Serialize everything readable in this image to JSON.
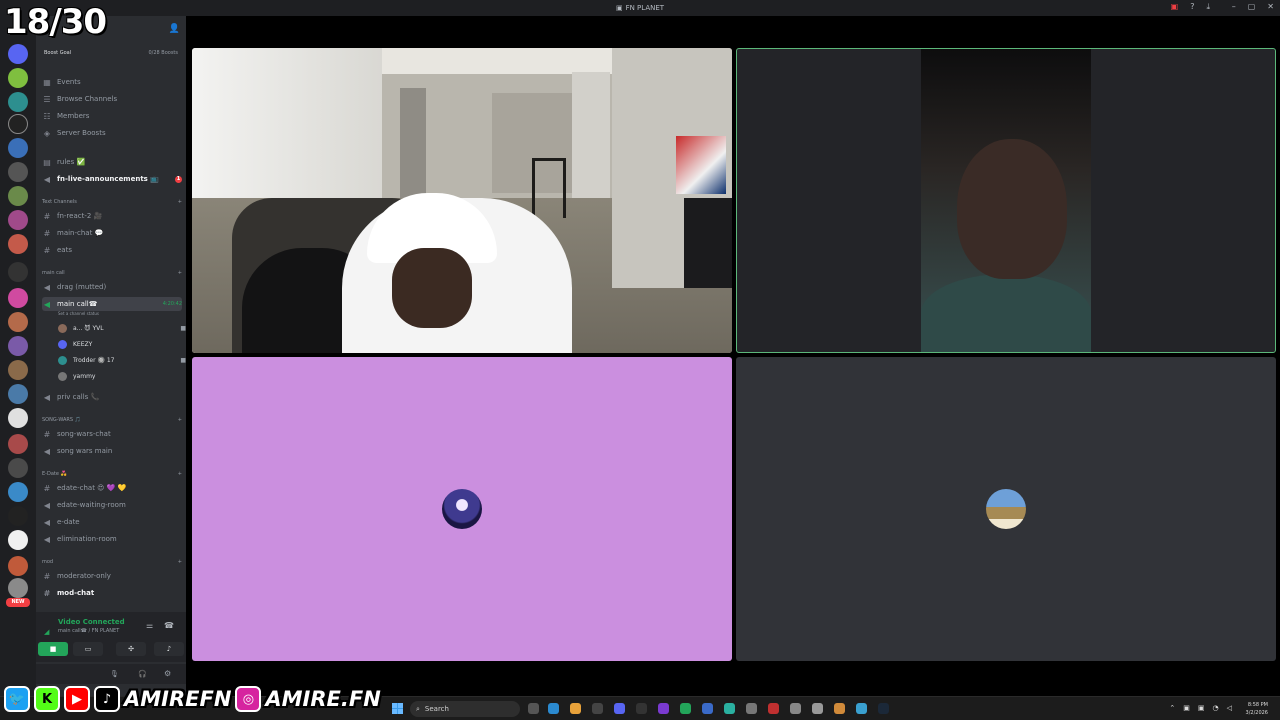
{
  "overlay": {
    "counter": "18/30",
    "social_handle_1": "AMIREFN",
    "social_handle_2": "AMIRE.FN"
  },
  "titlebar": {
    "title": "FN PLANET"
  },
  "sidebar": {
    "boost_goal": "Boost Goal",
    "boost_count": "0/28 Boosts",
    "nav": [
      "Events",
      "Browse Channels",
      "Members",
      "Server Boosts"
    ],
    "rules": "rules ✅",
    "announcements": "fn-live-announcements 📺",
    "announcements_unread": "1",
    "cat_text": "Text Channels",
    "text_channels": [
      "fn-react-2 🎥",
      "main-chat 💬",
      "eats"
    ],
    "cat_main_call": "main call",
    "drag": "drag (mutted)",
    "main_call": "main call☎",
    "main_call_timer": "4:20:42",
    "main_call_status": "Set a channel status",
    "vc_users": [
      {
        "name": "a... 😈 YVL"
      },
      {
        "name": "KEEZY"
      },
      {
        "name": "Trodder 🔘 17"
      },
      {
        "name": "yammy"
      }
    ],
    "priv_calls": "priv calls 📞",
    "cat_song_wars": "SONG-WARS 🎵",
    "song_wars": [
      "song-wars-chat",
      "song wars main"
    ],
    "cat_edate": "E-Date 💑",
    "edate": [
      "edate-chat 😍 💜 💛",
      "edate-waiting-room",
      "e-date",
      "elimination-room"
    ],
    "cat_mod": "mod",
    "mod": [
      "moderator-only",
      "mod-chat"
    ]
  },
  "voice_panel": {
    "status": "Video Connected",
    "location": "main call☎ / FN PLANET"
  },
  "taskbar": {
    "search_placeholder": "Search",
    "time": "8:58 PM",
    "date": "3/2/2026"
  },
  "colors": {
    "accent_green": "#23a55a",
    "unread_red": "#f23f43",
    "tile3_bg": "#cb8fdf"
  }
}
